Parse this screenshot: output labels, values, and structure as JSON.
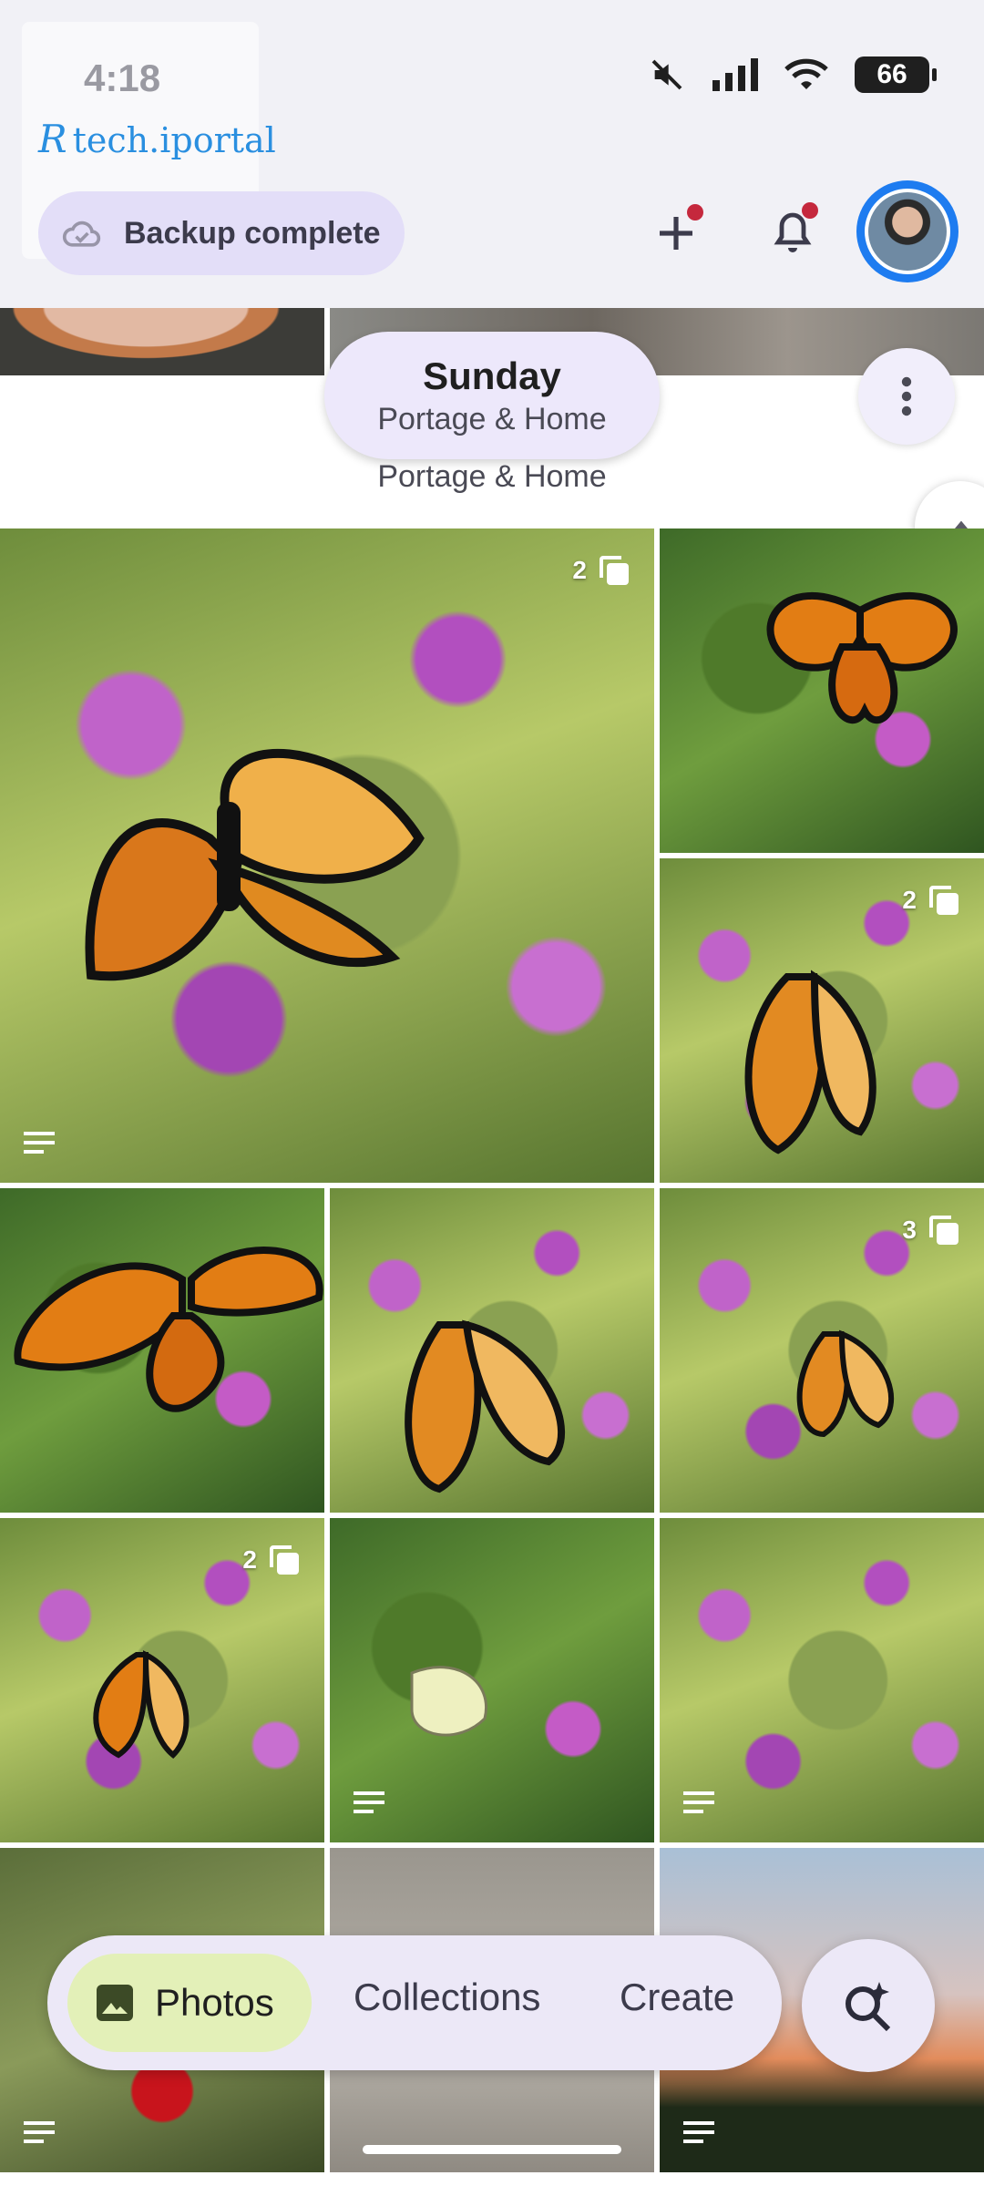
{
  "status_bar": {
    "time": "4:18",
    "battery": "66"
  },
  "watermark": {
    "text": "tech.iportal"
  },
  "header": {
    "backup_status": "Backup complete"
  },
  "date_section": {
    "day": "Sunday",
    "location": "Portage & Home",
    "section_location": "Portage & Home"
  },
  "badges": {
    "p1": "2",
    "p3": "2",
    "p6": "3",
    "p7": "2"
  },
  "bottom_nav": {
    "photos": "Photos",
    "collections": "Collections",
    "create": "Create"
  },
  "colors": {
    "accent": "#1e7cf0",
    "notification_dot": "#c5283d",
    "photos_tab_bg": "#e3f0b8"
  }
}
